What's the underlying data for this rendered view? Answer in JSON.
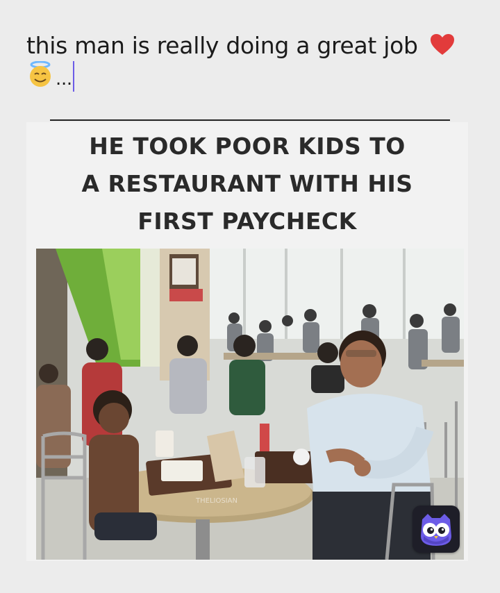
{
  "post": {
    "caption_text": "this man is really doing a great job",
    "caption_heart": "❤️",
    "caption_ellipsis": "...",
    "caption_icons": [
      "heart-icon",
      "smiling-face-with-halo-icon"
    ]
  },
  "meme": {
    "headline_lines": [
      "HE TOOK POOR KIDS TO",
      "A RESTAURANT WITH HIS",
      "FIRST PAYCHECK"
    ],
    "photo_description": "man eating with poor kids in a restaurant",
    "watermark_text": "THELIOSIAN"
  },
  "app": {
    "badge_icon": "owl-icon",
    "badge_color": "#6c5ce7"
  },
  "colors": {
    "background": "#ececec",
    "heart": "#e23b3b",
    "cursor": "#6c5ce7",
    "headline": "#2a2a2a"
  }
}
